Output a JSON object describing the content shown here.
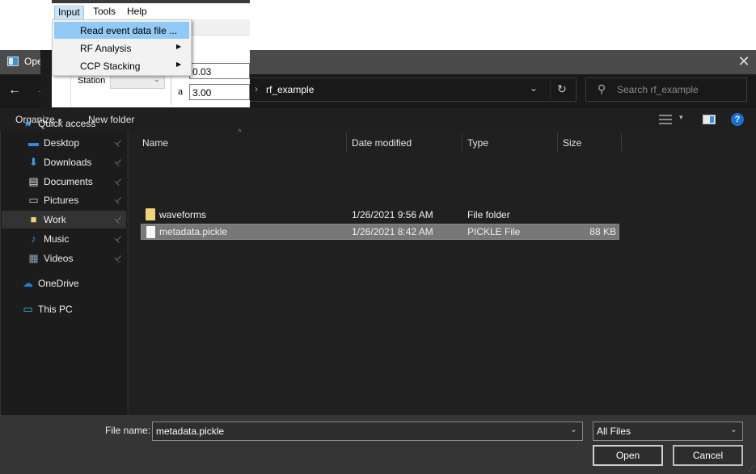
{
  "background_app": {
    "menubar": [
      "Input",
      "Tools",
      "Help"
    ],
    "active_menu": "Input",
    "dropdown": [
      {
        "label": "Read event data file ...",
        "submenu": false,
        "highlighted": true
      },
      {
        "label": "RF Analysis",
        "submenu": true,
        "highlighted": false
      },
      {
        "label": "CCP Stacking",
        "submenu": true,
        "highlighted": false
      }
    ],
    "station_label": "Station",
    "station_value": "",
    "field1_value": "0.03",
    "a_label": "a",
    "field2_value": "3.00"
  },
  "dialog": {
    "title": "Ope",
    "close_icon": "✕",
    "nav": {
      "back_icon": "←",
      "forward_icon": "→",
      "breadcrumb_sep": "›",
      "current_folder": "rf_example",
      "dropdown_icon": "⌄",
      "refresh_icon": "↻",
      "search_icon": "⚲",
      "search_placeholder": "Search rf_example"
    },
    "toolbar": {
      "organize": "Organize",
      "organize_caret": "▾",
      "new_folder": "New folder",
      "view_caret": "▾",
      "help": "?"
    },
    "sidebar": {
      "items": [
        {
          "label": "Quick access",
          "icon": "star-icon",
          "glyph": "★",
          "color": "#3d9be9",
          "pinned": false,
          "selected": false
        },
        {
          "label": "Desktop",
          "icon": "desktop-icon",
          "glyph": "▬",
          "color": "#2e8ee6",
          "pinned": true,
          "selected": false
        },
        {
          "label": "Downloads",
          "icon": "download-arrow-icon",
          "glyph": "⬇",
          "color": "#3c9be8",
          "pinned": true,
          "selected": false
        },
        {
          "label": "Documents",
          "icon": "document-icon",
          "glyph": "▤",
          "color": "#d8e2ea",
          "pinned": true,
          "selected": false
        },
        {
          "label": "Pictures",
          "icon": "pictures-icon",
          "glyph": "▭",
          "color": "#c6d4de",
          "pinned": true,
          "selected": false
        },
        {
          "label": "Work",
          "icon": "folder-icon",
          "glyph": "■",
          "color": "#f4d27a",
          "pinned": true,
          "selected": true
        },
        {
          "label": "Music",
          "icon": "music-note-icon",
          "glyph": "♪",
          "color": "#2f96e8",
          "pinned": true,
          "selected": false
        },
        {
          "label": "Videos",
          "icon": "film-icon",
          "glyph": "▦",
          "color": "#8aa0b0",
          "pinned": true,
          "selected": false
        },
        {
          "label": "OneDrive",
          "icon": "cloud-icon",
          "glyph": "☁",
          "color": "#1c7fd9",
          "pinned": false,
          "selected": false
        },
        {
          "label": "This PC",
          "icon": "computer-icon",
          "glyph": "▭",
          "color": "#4ab0f0",
          "pinned": false,
          "selected": false
        }
      ],
      "pin_glyph": "📌"
    },
    "filelist": {
      "sort_arrow": "^",
      "columns": [
        "Name",
        "Date modified",
        "Type",
        "Size"
      ],
      "rows": [
        {
          "name": "waveforms",
          "date": "1/26/2021 9:56 AM",
          "type": "File folder",
          "size": "",
          "kind": "folder",
          "selected": false
        },
        {
          "name": "metadata.pickle",
          "date": "1/26/2021 8:42 AM",
          "type": "PICKLE File",
          "size": "88 KB",
          "kind": "file",
          "selected": true
        }
      ]
    },
    "bottom": {
      "filename_label": "File name:",
      "filename_value": "metadata.pickle",
      "filetype_value": "All Files",
      "dropdown_icon": "⌄",
      "open_label": "Open",
      "cancel_label": "Cancel",
      "grip": "⋰"
    }
  },
  "colors": {
    "dialog_bg": "#202020",
    "titlebar": "#4a4a4a",
    "selection": "#777777",
    "menu_highlight": "#91c9f7",
    "accent_blue": "#1a6fd1",
    "folder_yellow": "#f4d27a"
  }
}
